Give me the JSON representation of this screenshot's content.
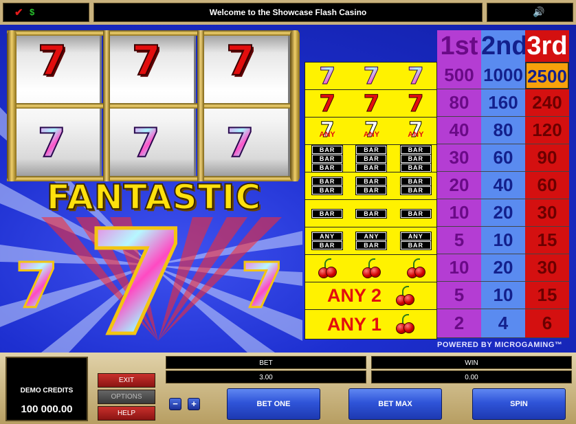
{
  "header": {
    "title": "Welcome to the Showcase Flash Casino",
    "icons": [
      "check-icon",
      "dollar-icon",
      "sound-icon"
    ]
  },
  "reels": {
    "top_row": [
      "7",
      "7",
      "7"
    ],
    "bottom_row": [
      "7",
      "7",
      "7"
    ]
  },
  "logo": {
    "title": "FANTASTIC",
    "big_symbol": "7",
    "side_symbol": "7"
  },
  "paytable": {
    "headers": [
      "1st",
      "2nd",
      "3rd"
    ],
    "rows": [
      {
        "symbol": "rainbow-7",
        "payouts": [
          "500",
          "1000",
          "2500"
        ]
      },
      {
        "symbol": "red-7",
        "payouts": [
          "80",
          "160",
          "240"
        ]
      },
      {
        "symbol": "any-7",
        "label": "ANY",
        "payouts": [
          "40",
          "80",
          "120"
        ]
      },
      {
        "symbol": "triple-bar",
        "label": "BAR",
        "payouts": [
          "30",
          "60",
          "90"
        ]
      },
      {
        "symbol": "double-bar",
        "label": "BAR",
        "payouts": [
          "20",
          "40",
          "60"
        ]
      },
      {
        "symbol": "single-bar",
        "label": "BAR",
        "payouts": [
          "10",
          "20",
          "30"
        ]
      },
      {
        "symbol": "any-bar",
        "label": "ANY",
        "sublabel": "BAR",
        "payouts": [
          "5",
          "10",
          "15"
        ]
      },
      {
        "symbol": "cherry",
        "payouts": [
          "10",
          "20",
          "30"
        ]
      },
      {
        "symbol": "any-2-cherry",
        "label": "ANY 2",
        "payouts": [
          "5",
          "10",
          "15"
        ]
      },
      {
        "symbol": "any-1-cherry",
        "label": "ANY 1",
        "payouts": [
          "2",
          "4",
          "6"
        ]
      }
    ],
    "highlighted": "2500"
  },
  "powered_by": "POWERED BY MICROGAMING™",
  "panel": {
    "credits_label": "DEMO CREDITS",
    "credits_value": "100 000.00",
    "exit_label": "EXIT",
    "options_label": "OPTIONS",
    "help_label": "HELP",
    "bet_label": "BET",
    "bet_value": "3.00",
    "win_label": "WIN",
    "win_value": "0.00",
    "minus_label": "−",
    "plus_label": "+",
    "bet_one_label": "BET ONE",
    "bet_max_label": "BET MAX",
    "spin_label": "SPIN"
  },
  "colors": {
    "background": "#1d2fd0",
    "gold": "#c9b27e",
    "col1": "#b43dd3",
    "col2": "#5a8bf0",
    "col3": "#d41010",
    "paytable_symbols": "#fff200",
    "highlight": "#f7a10b"
  }
}
